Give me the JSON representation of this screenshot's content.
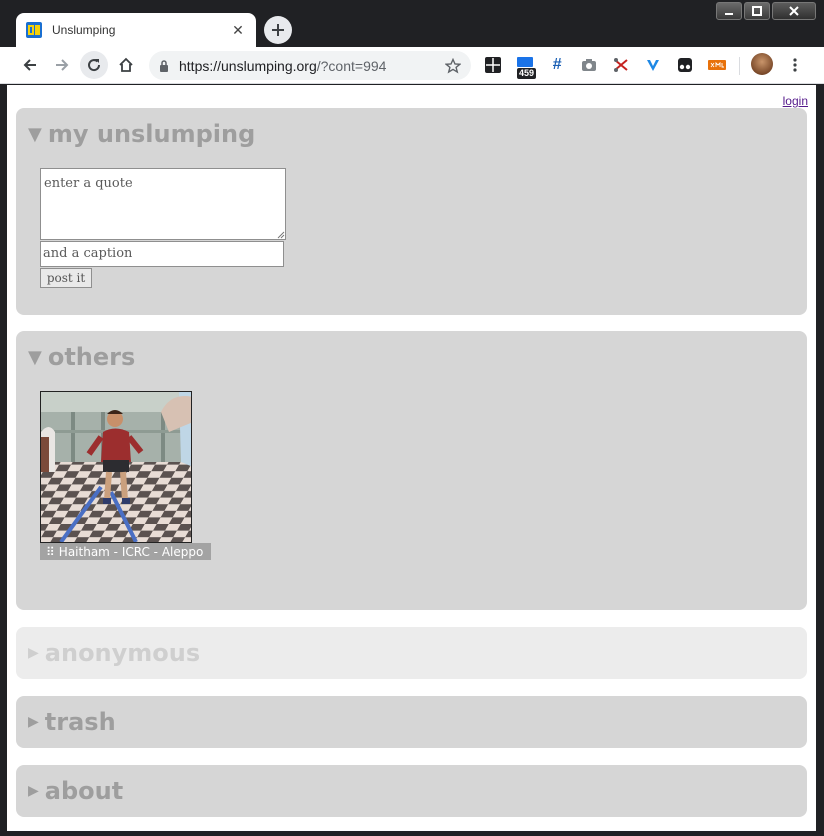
{
  "browser": {
    "tab_title": "Unslumping",
    "tab_close": "✕",
    "url_host": "https://unslumping.org",
    "url_path": "/?cont=994",
    "ext_badge": "459",
    "ext_hash": "#"
  },
  "page": {
    "login": "login",
    "panels": {
      "my": {
        "title": "my unslumping",
        "arrow": "▼",
        "quote_placeholder": "enter a quote",
        "caption_placeholder": "and a caption",
        "post_label": "post it"
      },
      "others": {
        "title": "others",
        "arrow": "▼",
        "item_caption": "Haitham - ICRC - Aleppo",
        "grip": "⠿"
      },
      "anonymous": {
        "title": "anonymous",
        "arrow": "▶"
      },
      "trash": {
        "title": "trash",
        "arrow": "▶"
      },
      "about": {
        "title": "about",
        "arrow": "▶"
      }
    }
  }
}
